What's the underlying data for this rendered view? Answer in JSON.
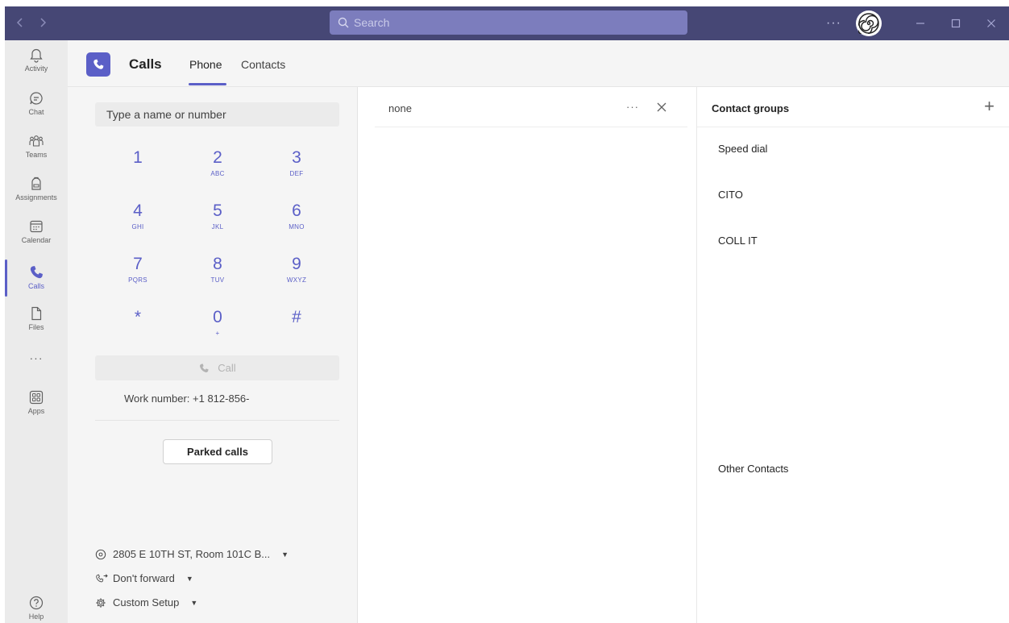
{
  "titlebar": {
    "back_icon": "chevron-left-icon",
    "forward_icon": "chevron-right-icon",
    "search_placeholder": "Search",
    "more_label": "···",
    "colors": {
      "bar": "#464775",
      "search": "#7c7dbd",
      "accent": "#5b5fc7"
    }
  },
  "rail": {
    "items": [
      {
        "label": "Activity",
        "icon": "bell-icon"
      },
      {
        "label": "Chat",
        "icon": "chat-icon"
      },
      {
        "label": "Teams",
        "icon": "teams-icon"
      },
      {
        "label": "Assignments",
        "icon": "backpack-icon"
      },
      {
        "label": "Calendar",
        "icon": "calendar-icon"
      },
      {
        "label": "Calls",
        "icon": "phone-icon"
      },
      {
        "label": "Files",
        "icon": "file-icon"
      },
      {
        "label": "Apps",
        "icon": "apps-icon"
      },
      {
        "label": "Help",
        "icon": "help-icon"
      }
    ],
    "more_label": "···",
    "active": "Calls"
  },
  "header": {
    "title": "Calls",
    "tabs": [
      {
        "label": "Phone",
        "active": true
      },
      {
        "label": "Contacts",
        "active": false
      }
    ]
  },
  "dialpad": {
    "input_placeholder": "Type a name or number",
    "keys": [
      {
        "digit": "1",
        "letters": ""
      },
      {
        "digit": "2",
        "letters": "ABC"
      },
      {
        "digit": "3",
        "letters": "DEF"
      },
      {
        "digit": "4",
        "letters": "GHI"
      },
      {
        "digit": "5",
        "letters": "JKL"
      },
      {
        "digit": "6",
        "letters": "MNO"
      },
      {
        "digit": "7",
        "letters": "PQRS"
      },
      {
        "digit": "8",
        "letters": "TUV"
      },
      {
        "digit": "9",
        "letters": "WXYZ"
      },
      {
        "digit": "*",
        "letters": ""
      },
      {
        "digit": "0",
        "letters": "+"
      },
      {
        "digit": "#",
        "letters": ""
      }
    ],
    "call_label": "Call",
    "work_number": "Work number: +1 812-856-",
    "parked_label": "Parked calls",
    "location": "2805 E 10TH ST, Room 101C B...",
    "forward": "Don't forward",
    "setup": "Custom Setup"
  },
  "middle": {
    "title": "none",
    "more_label": "···"
  },
  "contact_groups": {
    "title": "Contact groups",
    "add_label": "+",
    "groups": [
      "Speed dial",
      "CITO",
      "COLL IT",
      "Other Contacts"
    ]
  }
}
